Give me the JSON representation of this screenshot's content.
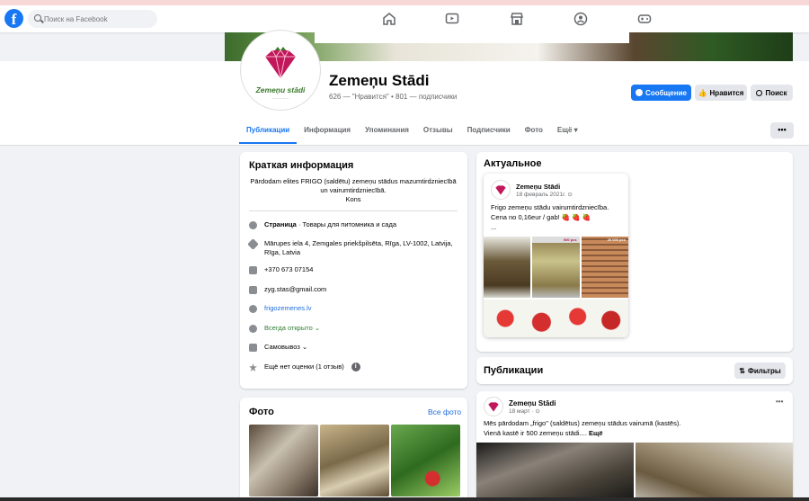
{
  "topbar": {
    "logo": "f",
    "search_placeholder": "Поиск на Facebook",
    "nav_icons": [
      "home-icon",
      "watch-icon",
      "marketplace-icon",
      "groups-icon",
      "gaming-icon"
    ]
  },
  "page": {
    "logo_brand": "Zemeņu stādi",
    "name": "Zemeņu Stādi",
    "stats": "626 — \"Нравится\" • 801 — подписчики"
  },
  "buttons": {
    "message": "Сообщение",
    "like": "Нравится",
    "search": "Поиск",
    "more": "•••"
  },
  "tabs": [
    {
      "label": "Публикации",
      "active": true
    },
    {
      "label": "Информация"
    },
    {
      "label": "Упоминания"
    },
    {
      "label": "Отзывы"
    },
    {
      "label": "Подписчики"
    },
    {
      "label": "Фото"
    },
    {
      "label": "Ещё ▾"
    }
  ],
  "intro": {
    "title": "Краткая информация",
    "description": "Pārdodam elites FRIGO (saldētu) zemeņu stādus mazumtirdzniecībā un vairumtirdzniecībā.",
    "description_more": "Kons",
    "category_label": "Страница",
    "category": " · Товары для питомника и сада",
    "address": "Mārupes iela 4, Zemgales priekšpilsēta, Rīga, LV-1002, Latvija, Rīga, Latvia",
    "phone": "+370 673 07154",
    "email": "zyg.stas@gmail.com",
    "website": "frigozemenes.lv",
    "hours": "Всегда открыто",
    "delivery": "Самовывоз",
    "rating": "Ещё нет оценки (1 отзыв)"
  },
  "photos": {
    "title": "Фото",
    "see_all": "Все фото"
  },
  "featured": {
    "title": "Актуальное",
    "author": "Zemeņu Stādi",
    "date": "18 февраль 2021г.",
    "text": "Frigo zemeņu stādu vairumtirdzniecība.",
    "price": "Cena no 0,16eur / gab!",
    "ellipsis": "...",
    "img_labels": [
      "500 pcs",
      "20 000 pcs"
    ]
  },
  "posts": {
    "title": "Публикации",
    "filter": "Фильтры",
    "author": "Zemeņu Stādi",
    "date": "18 март",
    "text1": "Mēs pārdodam „frigo\" (saldētus) zemeņu stādus vairumā (kastēs).",
    "text2": "Vienā kastē ir 500 zemeņu stādi....",
    "more": "Ещё",
    "menu": "•••"
  },
  "colors": {
    "accent": "#1877f2",
    "brand_pink": "#c2185b",
    "brand_green": "#3a7a2a"
  }
}
